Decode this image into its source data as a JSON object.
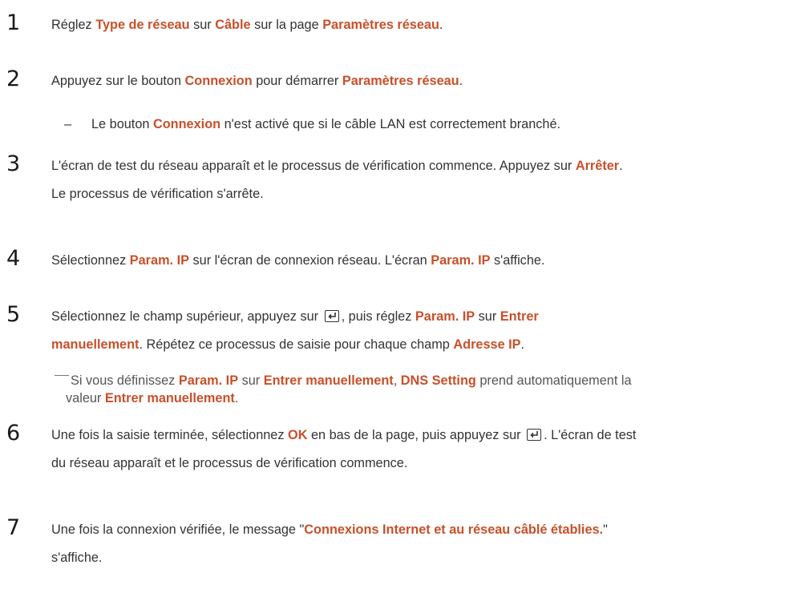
{
  "steps": [
    {
      "number": "1",
      "parts": [
        "Réglez ",
        "Type de réseau",
        " sur ",
        "Câble",
        " sur la page ",
        "Paramètres réseau",
        "."
      ]
    },
    {
      "number": "2",
      "parts": [
        "Appuyez sur le bouton ",
        "Connexion",
        " pour démarrer ",
        "Paramètres réseau",
        "."
      ],
      "note": {
        "dash": "–",
        "parts": [
          "Le bouton ",
          "Connexion",
          " n'est activé que si le câble LAN est correctement branché."
        ]
      }
    },
    {
      "number": "3",
      "parts": [
        "L'écran de test du réseau apparaît et le processus de vérification commence. Appuyez sur ",
        "Arrêter",
        "."
      ],
      "line2": "Le processus de vérification s'arrête."
    },
    {
      "number": "4",
      "parts": [
        "Sélectionnez ",
        "Param. IP",
        " sur l'écran de connexion réseau. L'écran ",
        "Param. IP",
        " s'affiche."
      ]
    },
    {
      "number": "5",
      "parts": [
        "Sélectionnez le champ supérieur, appuyez sur ",
        ", puis réglez ",
        "Param. IP",
        " sur ",
        "Entrer"
      ],
      "line2_parts": [
        "manuellement",
        ". Répétez ce processus de saisie pour chaque champ ",
        "Adresse IP",
        "."
      ],
      "note": {
        "parts": [
          "Si vous définissez ",
          "Param. IP",
          " sur ",
          "Entrer manuellement",
          ", ",
          "DNS Setting",
          " prend automatiquement la"
        ],
        "line2_parts": [
          "valeur ",
          "Entrer manuellement",
          "."
        ]
      }
    },
    {
      "number": "6",
      "parts": [
        "Une fois la saisie terminée, sélectionnez ",
        "OK",
        " en bas de la page, puis appuyez sur ",
        ". L'écran de test"
      ],
      "line2": "du réseau apparaît et le processus de vérification commence."
    },
    {
      "number": "7",
      "parts": [
        "Une fois la connexion vérifiée, le message \"",
        "Connexions Internet et au réseau câblé établies.",
        "\""
      ],
      "line2": "s'affiche."
    }
  ],
  "icons": {
    "enter_key": "enter-key-icon"
  },
  "colors": {
    "highlight": "#c8502a",
    "text": "#333333"
  }
}
